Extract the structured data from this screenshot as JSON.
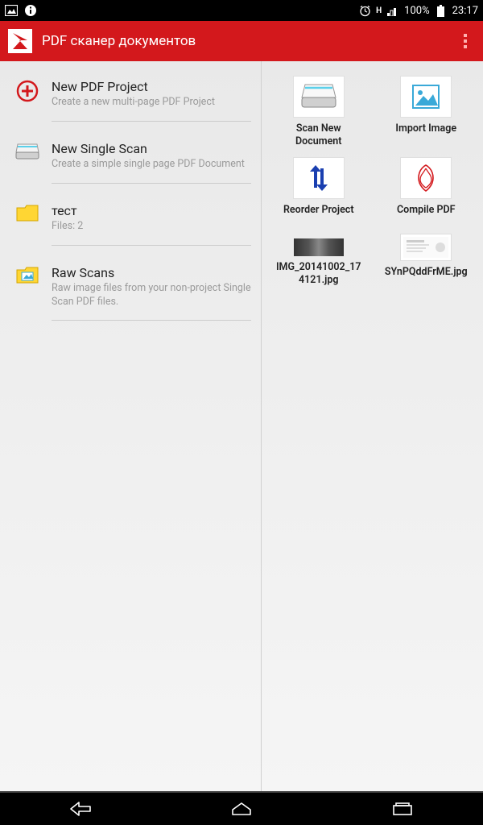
{
  "status": {
    "battery": "100%",
    "time": "23:17",
    "net_label": "H"
  },
  "header": {
    "title": "PDF сканер документов"
  },
  "left_items": [
    {
      "title": "New PDF Project",
      "subtitle": "Create a new multi-page PDF Project",
      "icon": "plus"
    },
    {
      "title": "New Single Scan",
      "subtitle": "Create a simple single page PDF Document",
      "icon": "scanner"
    },
    {
      "title": "тест",
      "subtitle": "Files: 2",
      "icon": "folder"
    },
    {
      "title": "Raw Scans",
      "subtitle": "Raw image files from your non-project Single Scan PDF files.",
      "icon": "folder-image"
    }
  ],
  "right_items": [
    {
      "label": "Scan New Document",
      "icon": "scanner"
    },
    {
      "label": "Import Image",
      "icon": "import-image"
    },
    {
      "label": "Reorder Project",
      "icon": "reorder"
    },
    {
      "label": "Compile PDF",
      "icon": "compile-pdf"
    },
    {
      "label": "IMG_20141002_174121.jpg",
      "icon": "thumb"
    },
    {
      "label": "SYnPQddFrME.jpg",
      "icon": "thumb2"
    }
  ]
}
